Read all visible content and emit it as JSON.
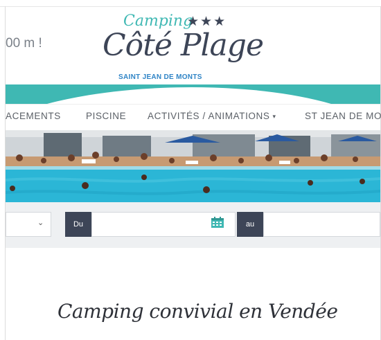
{
  "header": {
    "tagline": "00 m !",
    "logo": {
      "camping": "Camping",
      "stars": "★★★",
      "name": "Côté Plage",
      "location": "SAINT JEAN DE MONTS"
    }
  },
  "nav": {
    "items": [
      {
        "label": "ACEMENTS"
      },
      {
        "label": "PISCINE"
      },
      {
        "label": "ACTIVITÉS / ANIMATIONS",
        "has_dropdown": true
      },
      {
        "label": "ST JEAN DE MO"
      }
    ],
    "caret": "▾"
  },
  "search": {
    "select_caret": "⌄",
    "from_label": "Du",
    "to_label": "au"
  },
  "content": {
    "headline": "Camping convivial en Vendée"
  },
  "colors": {
    "teal": "#3fb8b3",
    "navy": "#3d4557",
    "blue": "#2f84c6",
    "pool": "#2bb6d6"
  }
}
